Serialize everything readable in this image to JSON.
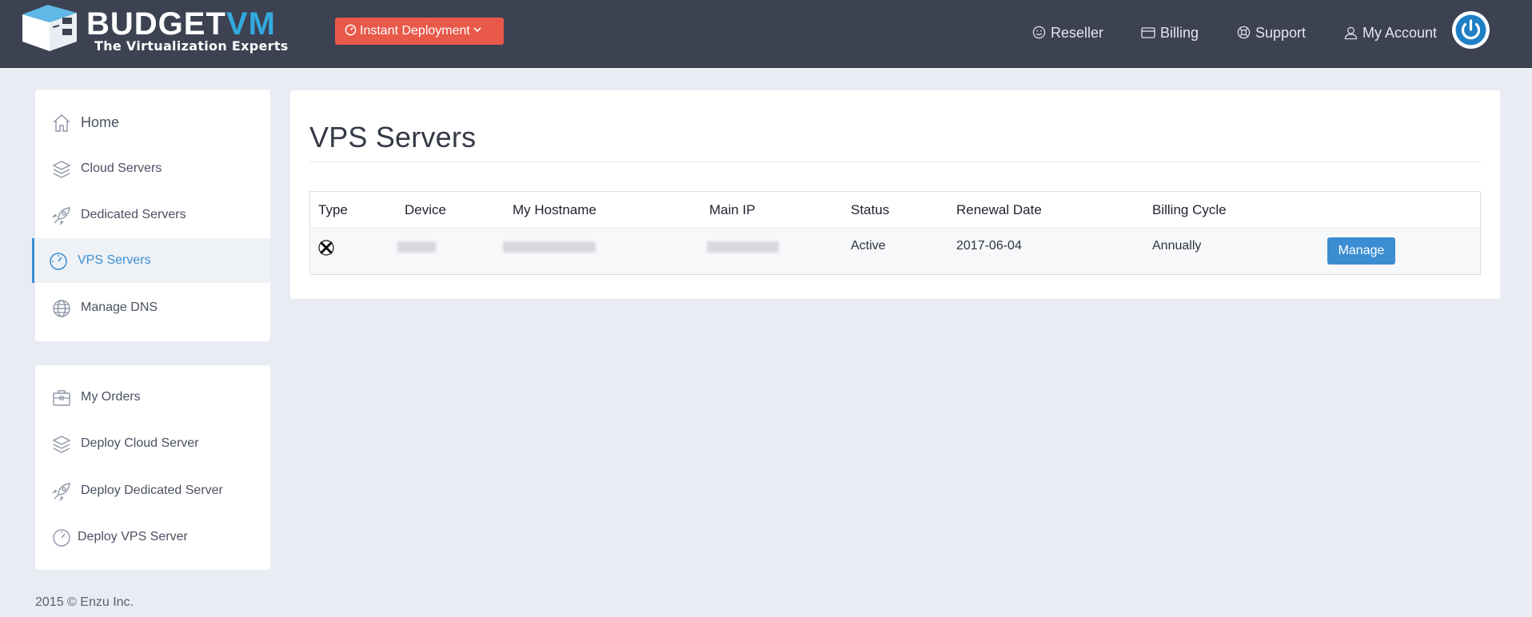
{
  "header": {
    "logo_word_a": "BUDGET",
    "logo_word_b": "VM",
    "logo_tagline": "The Virtualization Experts",
    "deploy_button_label": "Instant Deployment",
    "nav": [
      {
        "label": "Reseller",
        "icon": "smile-icon"
      },
      {
        "label": "Billing",
        "icon": "credit-card-icon"
      },
      {
        "label": "Support",
        "icon": "lifebuoy-icon"
      },
      {
        "label": "My Account",
        "icon": "user-icon"
      }
    ],
    "power_icon": "power-icon"
  },
  "sidebar": {
    "primary": [
      {
        "label": "Home",
        "icon": "home-icon"
      },
      {
        "label": "Cloud Servers",
        "icon": "layers-icon"
      },
      {
        "label": "Dedicated Servers",
        "icon": "rocket-icon"
      },
      {
        "label": "VPS Servers",
        "icon": "gauge-icon",
        "active": true
      },
      {
        "label": "Manage DNS",
        "icon": "globe-icon"
      }
    ],
    "secondary": [
      {
        "label": "My Orders",
        "icon": "briefcase-icon"
      },
      {
        "label": "Deploy Cloud Server",
        "icon": "layers-icon"
      },
      {
        "label": "Deploy Dedicated Server",
        "icon": "rocket-icon"
      },
      {
        "label": "Deploy VPS Server",
        "icon": "gauge-icon"
      }
    ]
  },
  "main": {
    "title": "VPS Servers",
    "table": {
      "columns": [
        "Type",
        "Device",
        "My Hostname",
        "Main IP",
        "Status",
        "Renewal Date",
        "Billing Cycle"
      ],
      "rows": [
        {
          "type_icon": "xen-icon",
          "device": "",
          "hostname": "",
          "main_ip": "",
          "status": "Active",
          "renewal_date": "2017-06-04",
          "billing_cycle": "Annually",
          "action_label": "Manage"
        }
      ]
    }
  },
  "footer": {
    "text": "2015 © Enzu Inc."
  },
  "colors": {
    "topbar": "#3c4252",
    "accent_blue": "#3b8ed2",
    "deploy_red": "#e8594a",
    "page_bg": "#eaecf3"
  }
}
